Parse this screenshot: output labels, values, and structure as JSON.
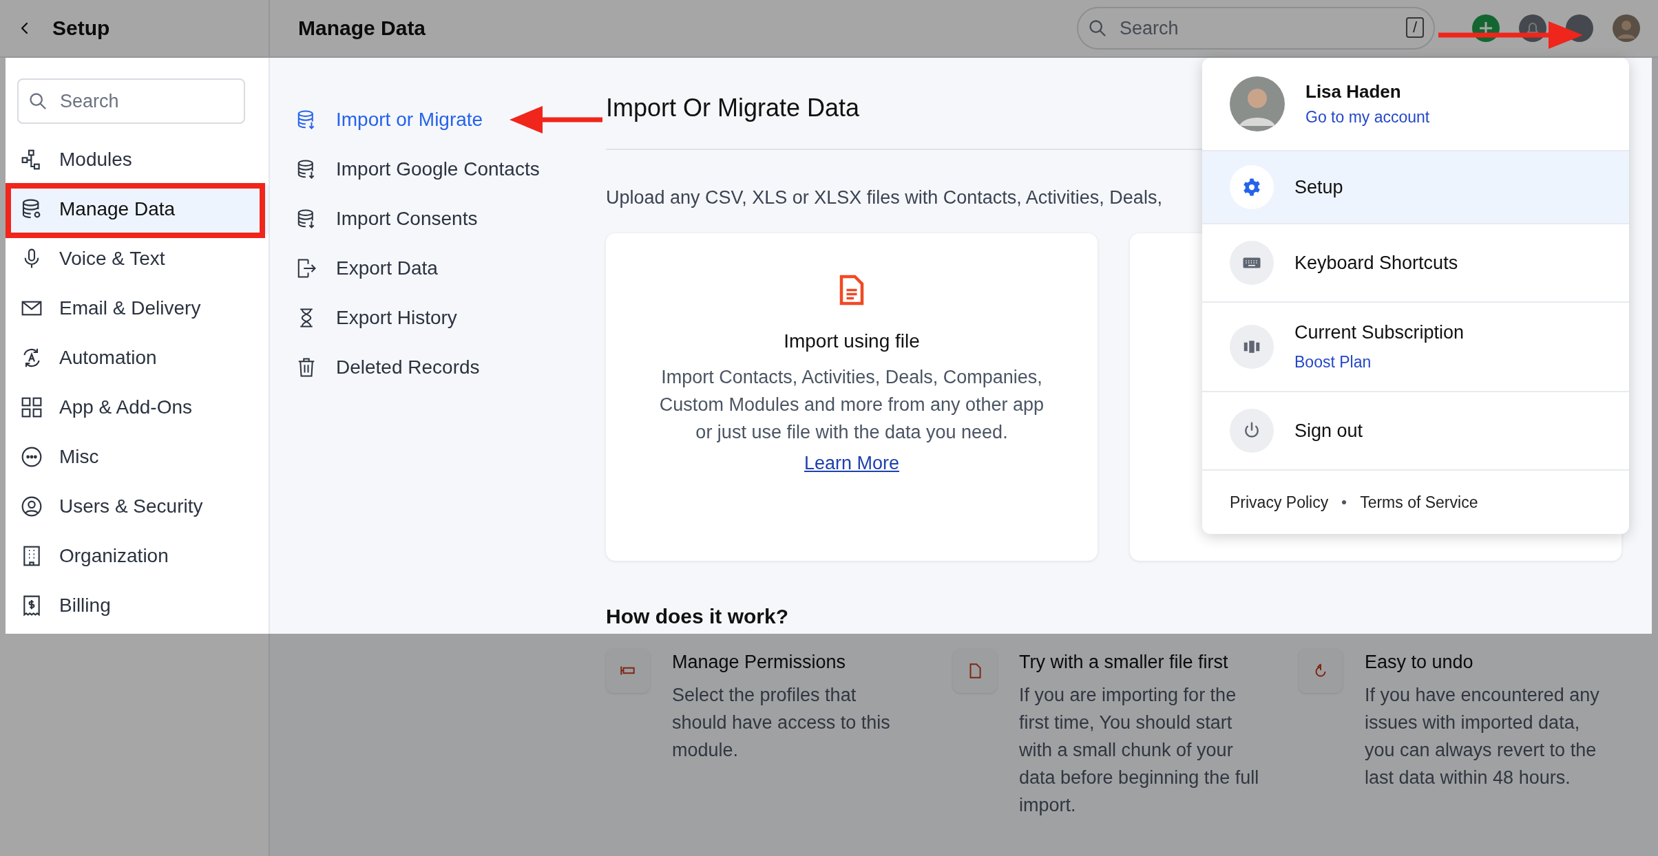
{
  "sidebar": {
    "title": "Setup",
    "search": {
      "placeholder": "Search"
    },
    "items": [
      {
        "label": "Modules",
        "selected": false
      },
      {
        "label": "Manage Data",
        "selected": true
      },
      {
        "label": "Voice & Text",
        "selected": false
      },
      {
        "label": "Email & Delivery",
        "selected": false
      },
      {
        "label": "Automation",
        "selected": false
      },
      {
        "label": "App & Add-Ons",
        "selected": false
      },
      {
        "label": "Misc",
        "selected": false
      },
      {
        "label": "Users & Security",
        "selected": false
      },
      {
        "label": "Organization",
        "selected": false
      },
      {
        "label": "Billing",
        "selected": false
      }
    ]
  },
  "topbar": {
    "title": "Manage Data",
    "search": {
      "placeholder": "Search",
      "shortcut": "/"
    }
  },
  "submenu": [
    {
      "label": "Import or Migrate",
      "selected": true
    },
    {
      "label": "Import Google Contacts",
      "selected": false
    },
    {
      "label": "Import Consents",
      "selected": false
    },
    {
      "label": "Export Data",
      "selected": false
    },
    {
      "label": "Export History",
      "selected": false
    },
    {
      "label": "Deleted Records",
      "selected": false
    }
  ],
  "content": {
    "title": "Import Or Migrate Data",
    "description": "Upload any CSV, XLS or XLSX files with Contacts, Activities, Deals,",
    "card": {
      "title": "Import using file",
      "text": "Import Contacts, Activities, Deals, Companies, Custom Modules and more from any other app or just use file with the data you need.",
      "link": "Learn More"
    }
  },
  "how_it_works": {
    "title": "How does it work?",
    "steps": [
      {
        "title": "Manage Permissions",
        "text": "Select the profiles that should have access to this module."
      },
      {
        "title": "Try with a smaller file first",
        "text": "If you are importing for the first time, You should start with a small chunk of your data before beginning the full import."
      },
      {
        "title": "Easy to undo",
        "text": "If you have encountered any issues with imported data, you can always revert to the last data within 48 hours."
      }
    ]
  },
  "account_menu": {
    "name": "Lisa Haden",
    "account_link": "Go to my account",
    "items": [
      {
        "label": "Setup",
        "selected": true
      },
      {
        "label": "Keyboard Shortcuts",
        "selected": false
      },
      {
        "label": "Current Subscription",
        "sublabel": "Boost Plan",
        "selected": false
      },
      {
        "label": "Sign out",
        "selected": false
      }
    ],
    "footer_links": [
      "Privacy Policy",
      "Terms of Service"
    ]
  }
}
